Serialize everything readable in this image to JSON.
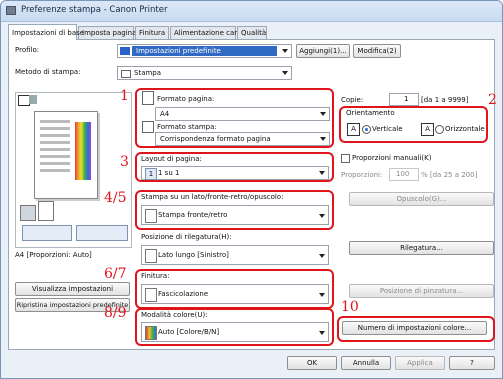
{
  "window": {
    "title": "Preferenze stampa - Canon Printer"
  },
  "tabs": [
    {
      "label": "Impostazioni di base"
    },
    {
      "label": "Imposta pagina"
    },
    {
      "label": "Finitura"
    },
    {
      "label": "Alimentazione carta"
    },
    {
      "label": "Qualità"
    }
  ],
  "profile": {
    "label": "Profilo:",
    "value": "Impostazioni predefinite",
    "add_button": "Aggiungi(1)...",
    "modify_button": "Modifica(2)"
  },
  "output_method": {
    "label": "Metodo di stampa:",
    "value": "Stampa"
  },
  "preview": {
    "caption": "A4 [Proporzioni: Auto]",
    "view_button": "Visualizza impostazioni",
    "restore_button": "Ripristina impostazioni predefinite"
  },
  "callouts": [
    "1",
    "2",
    "3",
    "4/5",
    "6/7",
    "8/9",
    "10"
  ],
  "page_size": {
    "label": "Formato pagina:",
    "value": "A4"
  },
  "output_size": {
    "label": "Formato stampa:",
    "value": "Corrispondenza formato pagina"
  },
  "copies": {
    "label": "Copie:",
    "value": "1",
    "range": "[da 1 a 9999]"
  },
  "orientation": {
    "label": "Orientamento",
    "portrait": "Verticale",
    "landscape": "Orizzontale",
    "selected": "Verticale"
  },
  "layout": {
    "label": "Layout di pagina:",
    "value": "1 su 1"
  },
  "manual_scaling": {
    "label": "Proporzioni manuali(K)",
    "scale_label": "Proporzioni:",
    "scale_value": "100",
    "scale_range": "% [da 25 a 200]"
  },
  "duplex": {
    "label": "Stampa su un lato/fronte-retro/opuscolo:",
    "value": "Stampa fronte/retro",
    "booklet_button": "Opuscolo(G)..."
  },
  "binding": {
    "label": "Posizione di rilegatura(H):",
    "value": "Lato lungo [Sinistro]",
    "binding_button": "Rilegatura..."
  },
  "finishing": {
    "label": "Finitura:",
    "value": "Fascicolazione",
    "staple_button": "Posizione di pinzatura..."
  },
  "color_mode": {
    "label": "Modalità colore(U):",
    "value": "Auto [Colore/B/N]",
    "color_settings_button": "Numero di impostazioni colore..."
  },
  "footer": {
    "ok": "OK",
    "cancel": "Annulla",
    "apply": "Applica",
    "help": "?"
  }
}
